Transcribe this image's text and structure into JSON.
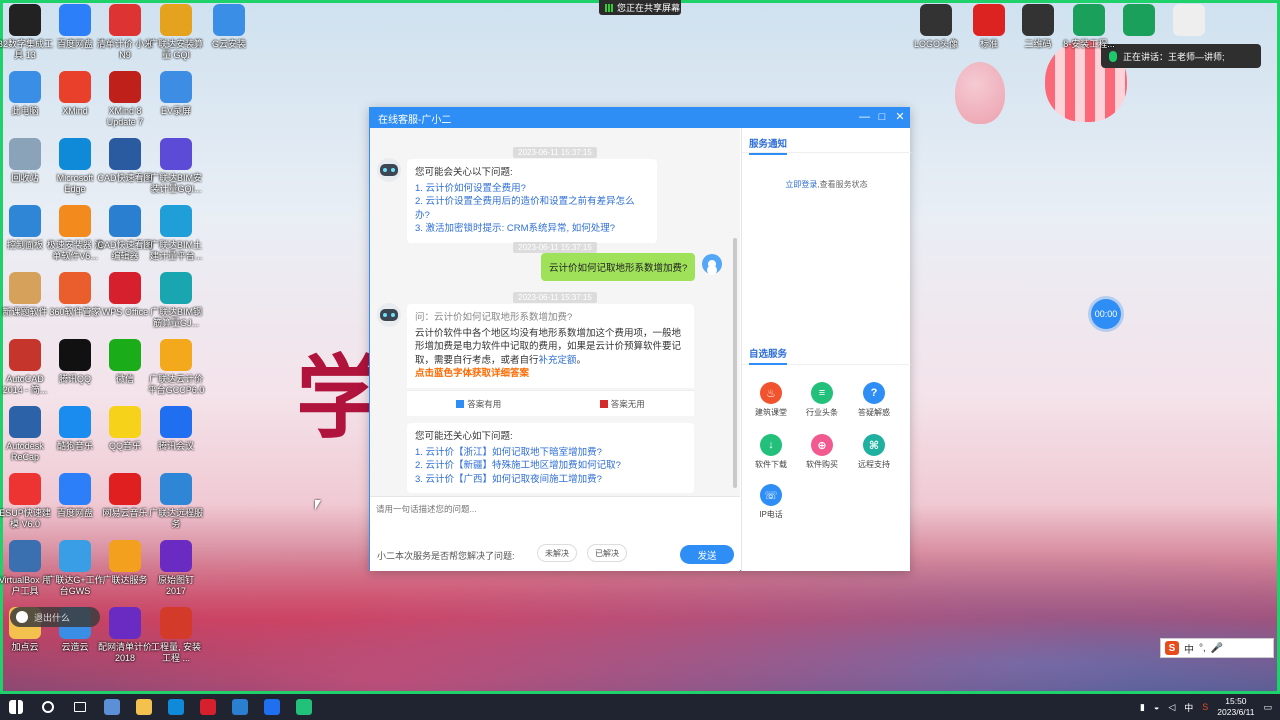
{
  "screen": {
    "share_bar": "您正在共享屏幕",
    "speaking": "正在讲话：王老师—讲师;",
    "timer": "00:00",
    "side_pill": "退出什么",
    "accent_green": "#1ed16a",
    "brand_blue": "#2f8ef5"
  },
  "desktop_icons": [
    {
      "label": "B2数字集成工具 13",
      "icon": "app-icon",
      "color": "#222"
    },
    {
      "label": "百度网盘",
      "icon": "cloud-icon",
      "color": "#2d7ff9"
    },
    {
      "label": "清单计价 小米N9",
      "icon": "app-icon",
      "color": "#d33"
    },
    {
      "label": "广联达安装算量 GQI",
      "icon": "app-icon",
      "color": "#e5a21f"
    },
    {
      "label": "G云安装",
      "icon": "file-icon",
      "color": "#3a8ee6"
    },
    {
      "label": "此电脑",
      "icon": "computer-icon",
      "color": "#3a8ee6"
    },
    {
      "label": "XMind",
      "icon": "xmind-icon",
      "color": "#e8402a"
    },
    {
      "label": "XMind 8 Update 7",
      "icon": "xmind-icon",
      "color": "#c0201a"
    },
    {
      "label": "EV录屏",
      "icon": "record-icon",
      "color": "#3c8de3"
    },
    {
      "label": "回收站",
      "icon": "trash-icon",
      "color": "#8aa3b8"
    },
    {
      "label": "Microsoft Edge",
      "icon": "edge-icon",
      "color": "#0f8ad8"
    },
    {
      "label": "CAD快速看图",
      "icon": "cad-icon",
      "color": "#2a5aa0"
    },
    {
      "label": "广联达BIM安装计量GQI...",
      "icon": "app-icon",
      "color": "#5b4bd6"
    },
    {
      "label": "控制面板",
      "icon": "settings-icon",
      "color": "#2f86d6"
    },
    {
      "label": "极速安装器 清单软件V6...",
      "icon": "app-icon",
      "color": "#f28a1d"
    },
    {
      "label": "CAD快速看图 编辑器",
      "icon": "cad-icon",
      "color": "#2a7fd1"
    },
    {
      "label": "广联达BIM土建计量平台...",
      "icon": "app-icon",
      "color": "#1f9ed8"
    },
    {
      "label": "新课题软件",
      "icon": "avatar-icon",
      "color": "#d6a25b"
    },
    {
      "label": "360软件管家",
      "icon": "app-icon",
      "color": "#ea5d2c"
    },
    {
      "label": "WPS Office",
      "icon": "wps-icon",
      "color": "#d6202e"
    },
    {
      "label": "广联达BIM钢筋算量GJ...",
      "icon": "app-icon",
      "color": "#1aa6b0"
    },
    {
      "label": "AutoCAD 2014 - 简...",
      "icon": "autocad-icon",
      "color": "#c6352b"
    },
    {
      "label": "腾讯QQ",
      "icon": "qq-icon",
      "color": "#111"
    },
    {
      "label": "微信",
      "icon": "wechat-icon",
      "color": "#1aad19"
    },
    {
      "label": "广联达云计价平台GCCP6.0",
      "icon": "app-icon",
      "color": "#f4a81c"
    },
    {
      "label": "Autodesk ReCap",
      "icon": "app-icon",
      "color": "#2b62a8"
    },
    {
      "label": "酷狗音乐",
      "icon": "music-icon",
      "color": "#1a8cf0"
    },
    {
      "label": "QQ音乐",
      "icon": "music-icon",
      "color": "#f6d21a"
    },
    {
      "label": "腾讯会议",
      "icon": "meeting-icon",
      "color": "#1f6ff0"
    },
    {
      "label": "ESUP快速建模 V6.0",
      "icon": "app-icon",
      "color": "#e33"
    },
    {
      "label": "百度网盘",
      "icon": "cloud-icon",
      "color": "#2d7ff9"
    },
    {
      "label": "网易云音乐",
      "icon": "music-icon",
      "color": "#e02020"
    },
    {
      "label": "广联达远程服务",
      "icon": "app-icon",
      "color": "#2f86d6"
    },
    {
      "label": "VirtualBox 用户工具",
      "icon": "app-icon",
      "color": "#3a6fb0"
    },
    {
      "label": "广联达G+工作台GWS",
      "icon": "app-icon",
      "color": "#3a9ee6"
    },
    {
      "label": "广联达服务",
      "icon": "app-icon",
      "color": "#f2a01e"
    },
    {
      "label": "原始图钉 2017",
      "icon": "pw-icon",
      "color": "#6a2bc2"
    },
    {
      "label": "加点云",
      "icon": "app-icon",
      "color": "#f2c14e"
    },
    {
      "label": "云造云",
      "icon": "cloud-icon",
      "color": "#3a8ee6"
    },
    {
      "label": "配网清单计价 2018",
      "icon": "pw-icon",
      "color": "#6a2bc2"
    },
    {
      "label": "工程量, 安装工程 ...",
      "icon": "box-icon",
      "color": "#d43a2a"
    }
  ],
  "top_right_icons": [
    {
      "label": "LOGO头像",
      "icon": "avatar-icon",
      "color": "#333"
    },
    {
      "label": "标准",
      "icon": "file-icon",
      "color": "#d22"
    },
    {
      "label": "二维码",
      "icon": "qr-icon",
      "color": "#333"
    },
    {
      "label": "8-安装工程...",
      "icon": "wps-sheet-icon",
      "color": "#1aa05a"
    },
    {
      "label": "",
      "icon": "wps-sheet-icon",
      "color": "#1aa05a"
    },
    {
      "label": "",
      "icon": "file-icon",
      "color": "#eee"
    }
  ],
  "chat": {
    "title": "在线客服-广小二",
    "window_buttons": {
      "minimize": "—",
      "maximize": "□",
      "close": "✕"
    },
    "ts1": "2023-06-11 15:37:15",
    "ts2": "2023-06-11 15:37:15",
    "ts3": "2023-06-11 15:37:15",
    "intro": "您可能会关心以下问题:",
    "intro_questions": [
      "1. 云计价如何设置全费用?",
      "2. 云计价设置全费用后的造价和设置之前有差异怎么办?",
      "3. 激活加密锁时提示: CRM系统异常, 如何处理?"
    ],
    "user_message": "云计价如何记取地形系数增加费?",
    "answer_question": "问：云计价如何记取地形系数增加费?",
    "answer_body": "云计价软件中各个地区均没有地形系数增加这个费用项，一般地形增加费是电力软件中记取的费用，如果是云计价预算软件要记取，需要自行考虑，或者自行",
    "answer_link": "补充定额",
    "answer_end": "。",
    "answer_hint": "点击蓝色字体获取详细答案",
    "vote_useful": "答案有用",
    "vote_useless": "答案无用",
    "more_intro": "您可能还关心如下问题:",
    "more_questions": [
      "1. 云计价【浙江】如何记取地下暗室增加费?",
      "2. 云计价【新疆】特殊施工地区增加费如何记取?",
      "3. 云计价【广西】如何记取夜间施工增加费?"
    ],
    "input_placeholder": "请用一句话描述您的问题...",
    "feedback_question": "小二本次服务是否帮您解决了问题:",
    "unresolved": "未解决",
    "resolved": "已解决",
    "send": "发送"
  },
  "side_panel": {
    "notice_title": "服务通知",
    "login_link": "立即登录",
    "login_suffix": ",查看服务状态",
    "services_title": "自选服务",
    "services": [
      {
        "label": "建筑课堂",
        "icon": "fire-icon",
        "color": "#f2532f"
      },
      {
        "label": "行业头条",
        "icon": "news-icon",
        "color": "#22c07a"
      },
      {
        "label": "答疑解惑",
        "icon": "question-icon",
        "color": "#2f8ef5"
      },
      {
        "label": "软件下载",
        "icon": "download-icon",
        "color": "#22c07a"
      },
      {
        "label": "软件购买",
        "icon": "cart-icon",
        "color": "#f25a8f"
      },
      {
        "label": "远程支持",
        "icon": "remote-icon",
        "color": "#1fb0a0"
      },
      {
        "label": "IP电话",
        "icon": "phone-icon",
        "color": "#2f8ef5"
      }
    ]
  },
  "ime": {
    "s": "S",
    "lang": "中",
    "punct": "°,",
    "mic": "🎤"
  },
  "taskbar": {
    "apps": [
      {
        "name": "start-button",
        "color": "#ffffff"
      },
      {
        "name": "search-button",
        "color": "#ffffff"
      },
      {
        "name": "task-view-button",
        "color": "#ffffff"
      },
      {
        "name": "calculator-app",
        "color": "#5b8fd6"
      },
      {
        "name": "file-explorer-app",
        "color": "#f2c14e"
      },
      {
        "name": "edge-app",
        "color": "#0f8ad8"
      },
      {
        "name": "wps-app",
        "color": "#d6202e"
      },
      {
        "name": "preview-app",
        "color": "#2a7fd1"
      },
      {
        "name": "meeting-app",
        "color": "#1f6ff0"
      },
      {
        "name": "sheets-app",
        "color": "#22c07a"
      }
    ],
    "tray_lang": "中",
    "time": "15:50",
    "date": "2023/6/11"
  }
}
